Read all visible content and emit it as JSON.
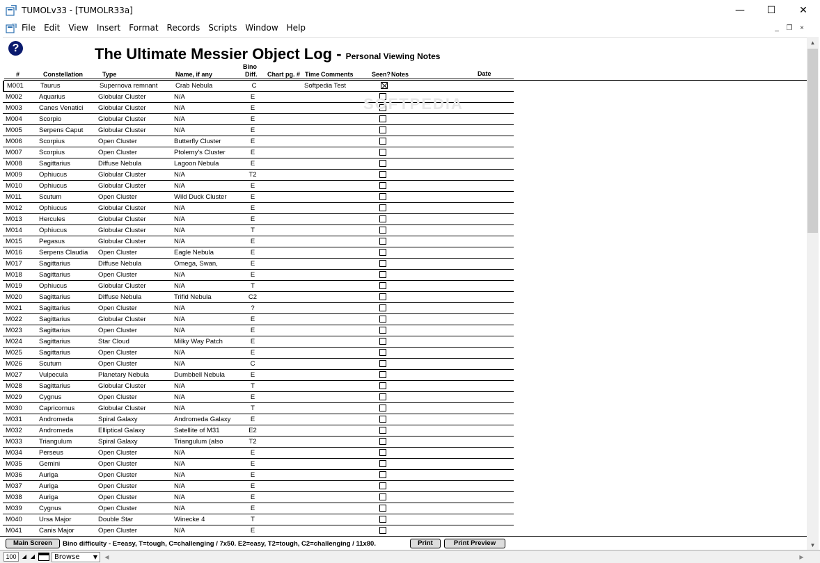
{
  "window": {
    "title": "TUMOLv33 - [TUMOLR33a]",
    "min_glyph": "—",
    "max_glyph": "☐",
    "close_glyph": "✕"
  },
  "menu": [
    "File",
    "Edit",
    "View",
    "Insert",
    "Format",
    "Records",
    "Scripts",
    "Window",
    "Help"
  ],
  "mdi": {
    "min": "_",
    "restore": "❐",
    "close": "×"
  },
  "page": {
    "help_glyph": "?",
    "title": "The Ultimate Messier Object Log - ",
    "subtitle": "Personal Viewing Notes",
    "watermark": "SOFTPEDIA"
  },
  "headers": {
    "num": "#",
    "constellation": "Constellation",
    "type": "Type",
    "name": "Name, if any",
    "bino_top": "Bino",
    "bino_bottom": "Diff.",
    "chart": "Chart pg. #",
    "time": "Time",
    "comments": "Comments",
    "seen": "Seen?",
    "notes": "Notes",
    "date": "Date"
  },
  "rows": [
    {
      "id": "M001",
      "con": "Taurus",
      "type": "Supernova remnant",
      "name": "Crab Nebula",
      "bino": "C",
      "comment": "Softpedia Test",
      "seen": true
    },
    {
      "id": "M002",
      "con": "Aquarius",
      "type": "Globular Cluster",
      "name": "N/A",
      "bino": "E",
      "comment": "",
      "seen": false
    },
    {
      "id": "M003",
      "con": "Canes Venatici",
      "type": "Globular Cluster",
      "name": "N/A",
      "bino": "E",
      "comment": "",
      "seen": false
    },
    {
      "id": "M004",
      "con": "Scorpio",
      "type": "Globular Cluster",
      "name": "N/A",
      "bino": "E",
      "comment": "",
      "seen": false
    },
    {
      "id": "M005",
      "con": "Serpens Caput",
      "type": "Globular Cluster",
      "name": "N/A",
      "bino": "E",
      "comment": "",
      "seen": false
    },
    {
      "id": "M006",
      "con": "Scorpius",
      "type": "Open Cluster",
      "name": "Butterfly Cluster",
      "bino": "E",
      "comment": "",
      "seen": false
    },
    {
      "id": "M007",
      "con": "Scorpius",
      "type": "Open Cluster",
      "name": "Ptolemy's Cluster",
      "bino": "E",
      "comment": "",
      "seen": false
    },
    {
      "id": "M008",
      "con": "Sagittarius",
      "type": "Diffuse Nebula",
      "name": "Lagoon Nebula",
      "bino": "E",
      "comment": "",
      "seen": false
    },
    {
      "id": "M009",
      "con": "Ophiucus",
      "type": "Globular Cluster",
      "name": "N/A",
      "bino": "T2",
      "comment": "",
      "seen": false
    },
    {
      "id": "M010",
      "con": "Ophiucus",
      "type": "Globular Cluster",
      "name": "N/A",
      "bino": "E",
      "comment": "",
      "seen": false
    },
    {
      "id": "M011",
      "con": "Scutum",
      "type": "Open Cluster",
      "name": "Wild Duck Cluster",
      "bino": "E",
      "comment": "",
      "seen": false
    },
    {
      "id": "M012",
      "con": "Ophiucus",
      "type": "Globular Cluster",
      "name": "N/A",
      "bino": "E",
      "comment": "",
      "seen": false
    },
    {
      "id": "M013",
      "con": "Hercules",
      "type": "Globular Cluster",
      "name": "N/A",
      "bino": "E",
      "comment": "",
      "seen": false
    },
    {
      "id": "M014",
      "con": "Ophiucus",
      "type": "Globular Cluster",
      "name": "N/A",
      "bino": "T",
      "comment": "",
      "seen": false
    },
    {
      "id": "M015",
      "con": "Pegasus",
      "type": "Globular Cluster",
      "name": "N/A",
      "bino": "E",
      "comment": "",
      "seen": false
    },
    {
      "id": "M016",
      "con": "Serpens Claudia",
      "type": "Open Cluster",
      "name": "Eagle Nebula",
      "bino": "E",
      "comment": "",
      "seen": false
    },
    {
      "id": "M017",
      "con": "Sagittarius",
      "type": "Diffuse Nebula",
      "name": "Omega, Swan,",
      "bino": "E",
      "comment": "",
      "seen": false
    },
    {
      "id": "M018",
      "con": "Sagittarius",
      "type": "Open Cluster",
      "name": "N/A",
      "bino": "E",
      "comment": "",
      "seen": false
    },
    {
      "id": "M019",
      "con": "Ophiucus",
      "type": "Globular Cluster",
      "name": "N/A",
      "bino": "T",
      "comment": "",
      "seen": false
    },
    {
      "id": "M020",
      "con": "Sagittarius",
      "type": "Diffuse Nebula",
      "name": "Trifid Nebula",
      "bino": "C2",
      "comment": "",
      "seen": false
    },
    {
      "id": "M021",
      "con": "Sagittarius",
      "type": "Open Cluster",
      "name": "N/A",
      "bino": "?",
      "comment": "",
      "seen": false
    },
    {
      "id": "M022",
      "con": "Sagittarius",
      "type": "Globular Cluster",
      "name": "N/A",
      "bino": "E",
      "comment": "",
      "seen": false
    },
    {
      "id": "M023",
      "con": "Sagittarius",
      "type": "Open Cluster",
      "name": "N/A",
      "bino": "E",
      "comment": "",
      "seen": false
    },
    {
      "id": "M024",
      "con": "Sagittarius",
      "type": "Star Cloud",
      "name": "Milky Way Patch",
      "bino": "E",
      "comment": "",
      "seen": false
    },
    {
      "id": "M025",
      "con": "Sagittarius",
      "type": "Open Cluster",
      "name": "N/A",
      "bino": "E",
      "comment": "",
      "seen": false
    },
    {
      "id": "M026",
      "con": "Scutum",
      "type": "Open Cluster",
      "name": "N/A",
      "bino": "C",
      "comment": "",
      "seen": false
    },
    {
      "id": "M027",
      "con": "Vulpecula",
      "type": "Planetary Nebula",
      "name": "Dumbbell Nebula",
      "bino": "E",
      "comment": "",
      "seen": false
    },
    {
      "id": "M028",
      "con": "Sagittarius",
      "type": "Globular Cluster",
      "name": "N/A",
      "bino": "T",
      "comment": "",
      "seen": false
    },
    {
      "id": "M029",
      "con": "Cygnus",
      "type": "Open Cluster",
      "name": "N/A",
      "bino": "E",
      "comment": "",
      "seen": false
    },
    {
      "id": "M030",
      "con": "Capricornus",
      "type": "Globular Cluster",
      "name": "N/A",
      "bino": "T",
      "comment": "",
      "seen": false
    },
    {
      "id": "M031",
      "con": "Andromeda",
      "type": "Spiral Galaxy",
      "name": "Andromeda Galaxy",
      "bino": "E",
      "comment": "",
      "seen": false
    },
    {
      "id": "M032",
      "con": "Andromeda",
      "type": "Elliptical Galaxy",
      "name": "Satellite of M31",
      "bino": "E2",
      "comment": "",
      "seen": false
    },
    {
      "id": "M033",
      "con": "Triangulum",
      "type": "Spiral Galaxy",
      "name": "Triangulum (also",
      "bino": "T2",
      "comment": "",
      "seen": false
    },
    {
      "id": "M034",
      "con": "Perseus",
      "type": "Open Cluster",
      "name": "N/A",
      "bino": "E",
      "comment": "",
      "seen": false
    },
    {
      "id": "M035",
      "con": "Gemini",
      "type": "Open Cluster",
      "name": "N/A",
      "bino": "E",
      "comment": "",
      "seen": false
    },
    {
      "id": "M036",
      "con": "Auriga",
      "type": "Open Cluster",
      "name": "N/A",
      "bino": "E",
      "comment": "",
      "seen": false
    },
    {
      "id": "M037",
      "con": "Auriga",
      "type": "Open Cluster",
      "name": "N/A",
      "bino": "E",
      "comment": "",
      "seen": false
    },
    {
      "id": "M038",
      "con": "Auriga",
      "type": "Open Cluster",
      "name": "N/A",
      "bino": "E",
      "comment": "",
      "seen": false
    },
    {
      "id": "M039",
      "con": "Cygnus",
      "type": "Open Cluster",
      "name": "N/A",
      "bino": "E",
      "comment": "",
      "seen": false
    },
    {
      "id": "M040",
      "con": "Ursa Major",
      "type": "Double Star",
      "name": "Winecke 4",
      "bino": "T",
      "comment": "",
      "seen": false
    },
    {
      "id": "M041",
      "con": "Canis Major",
      "type": "Open Cluster",
      "name": "N/A",
      "bino": "E",
      "comment": "",
      "seen": false
    }
  ],
  "footer": {
    "main_screen": "Main Screen",
    "note": "Bino difficulty - E=easy, T=tough, C=challenging / 7x50. E2=easy, T2=tough, C2=challenging / 11x80.",
    "print": "Print",
    "print_preview": "Print Preview"
  },
  "status": {
    "zoom": "100",
    "mode": "Browse"
  }
}
